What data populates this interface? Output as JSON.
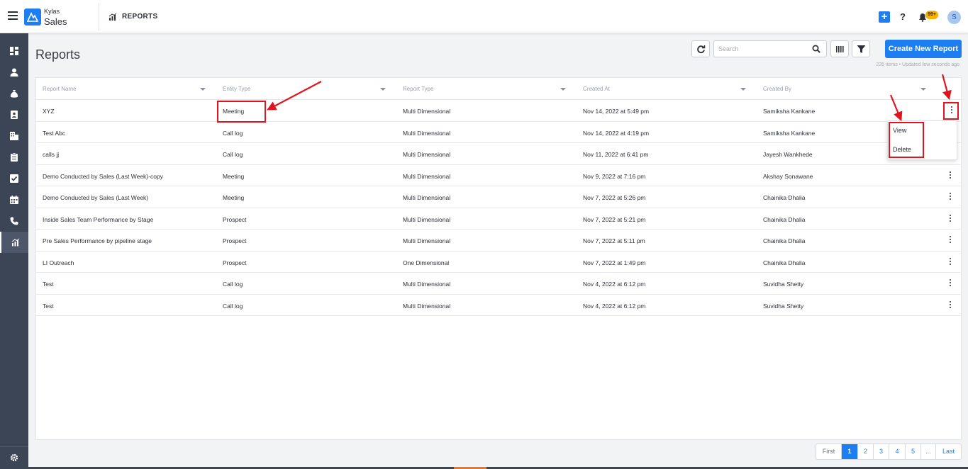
{
  "topbar": {
    "brand_top": "Kylas",
    "brand_main": "Sales",
    "breadcrumb": "REPORTS",
    "notification_badge": "99+",
    "avatar_initial": "S",
    "help_label": "?",
    "add_label": "+"
  },
  "sidebar": {
    "items": [
      {
        "icon": "dashboard-icon"
      },
      {
        "icon": "user-icon"
      },
      {
        "icon": "money-bag-icon"
      },
      {
        "icon": "contact-card-icon"
      },
      {
        "icon": "building-icon"
      },
      {
        "icon": "clipboard-icon"
      },
      {
        "icon": "checkbox-icon"
      },
      {
        "icon": "calendar-icon"
      },
      {
        "icon": "phone-icon"
      },
      {
        "icon": "reports-icon",
        "active": true
      }
    ],
    "bottom_icon": "gear-icon"
  },
  "page": {
    "title": "Reports",
    "search_placeholder": "Search",
    "create_button": "Create New Report",
    "meta": "235 items • Updated few seconds ago"
  },
  "table": {
    "columns": [
      "Report Name",
      "Entity Type",
      "Report Type",
      "Created At",
      "Created By"
    ],
    "rows": [
      [
        "XYZ",
        "Meeting",
        "Multi Dimensional",
        "Nov 14, 2022 at 5:49 pm",
        "Samiksha Kankane"
      ],
      [
        "Test Abc",
        "Call log",
        "Multi Dimensional",
        "Nov 14, 2022 at 4:19 pm",
        "Samiksha Kankane"
      ],
      [
        "calls jj",
        "Call log",
        "Multi Dimensional",
        "Nov 11, 2022 at 6:41 pm",
        "Jayesh Wankhede"
      ],
      [
        "Demo Conducted by Sales (Last Week)-copy",
        "Meeting",
        "Multi Dimensional",
        "Nov 9, 2022 at 7:16 pm",
        "Akshay Sonawane"
      ],
      [
        "Demo Conducted by Sales (Last Week)",
        "Meeting",
        "Multi Dimensional",
        "Nov 7, 2022 at 5:26 pm",
        "Chainika Dhalia"
      ],
      [
        "Inside Sales Team Performance by Stage",
        "Prospect",
        "Multi Dimensional",
        "Nov 7, 2022 at 5:21 pm",
        "Chainika Dhalia"
      ],
      [
        "Pre Sales Performance by pipeline stage",
        "Prospect",
        "Multi Dimensional",
        "Nov 7, 2022 at 5:11 pm",
        "Chainika Dhalia"
      ],
      [
        "LI Outreach",
        "Prospect",
        "One Dimensional",
        "Nov 7, 2022 at 1:49 pm",
        "Chainika Dhalia"
      ],
      [
        "Test",
        "Call log",
        "Multi Dimensional",
        "Nov 4, 2022 at 6:12 pm",
        "Suvidha Shetty"
      ],
      [
        "Test",
        "Call log",
        "Multi Dimensional",
        "Nov 4, 2022 at 6:12 pm",
        "Suvidha Shetty"
      ]
    ]
  },
  "dropdown": {
    "items": [
      "View",
      "Delete"
    ]
  },
  "pagination": {
    "first": "First",
    "pages": [
      "1",
      "2",
      "3",
      "4",
      "5"
    ],
    "ellipsis": "...",
    "last": "Last",
    "current": "1"
  },
  "colors": {
    "accent": "#1c7ef0",
    "sidebar": "#3c4556",
    "annotation": "#e0141e"
  }
}
